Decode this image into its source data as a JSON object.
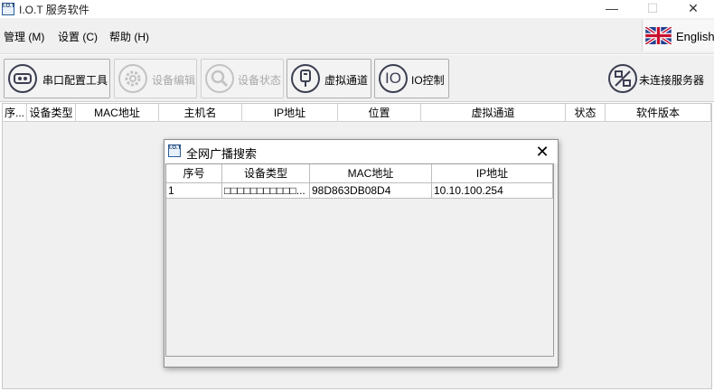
{
  "window": {
    "title": "I.O.T 服务软件",
    "icon_text": "I.O.T",
    "minimize": "—",
    "maximize": "☐",
    "close": "✕"
  },
  "menu": {
    "items": [
      "管理 (M)",
      "设置 (C)",
      "帮助 (H)"
    ],
    "language": "English"
  },
  "toolbar": {
    "buttons": [
      {
        "label": "串口配置工具",
        "enabled": true
      },
      {
        "label": "设备编辑",
        "enabled": false
      },
      {
        "label": "设备状态",
        "enabled": false
      },
      {
        "label": "虚拟通道",
        "enabled": true
      },
      {
        "label": "IO控制",
        "enabled": true
      },
      {
        "label": "未连接服务器",
        "enabled": true
      }
    ],
    "io_icon_text": "IO"
  },
  "main_table": {
    "columns": [
      "序...",
      "设备类型",
      "MAC地址",
      "主机名",
      "IP地址",
      "位置",
      "虚拟通道",
      "状态",
      "软件版本"
    ],
    "rows": []
  },
  "dialog": {
    "title": "全网广播搜索",
    "close": "✕",
    "columns": [
      "序号",
      "设备类型",
      "MAC地址",
      "IP地址"
    ],
    "rows": [
      {
        "index": "1",
        "device_type": "□□□□□□□□□□□...",
        "mac": "98D863DB08D4",
        "ip": "10.10.100.254"
      }
    ]
  },
  "colors": {
    "icon_stroke": "#3c3f52",
    "disabled_text": "#a8a8a8",
    "window_bg": "#f0f0f0"
  }
}
